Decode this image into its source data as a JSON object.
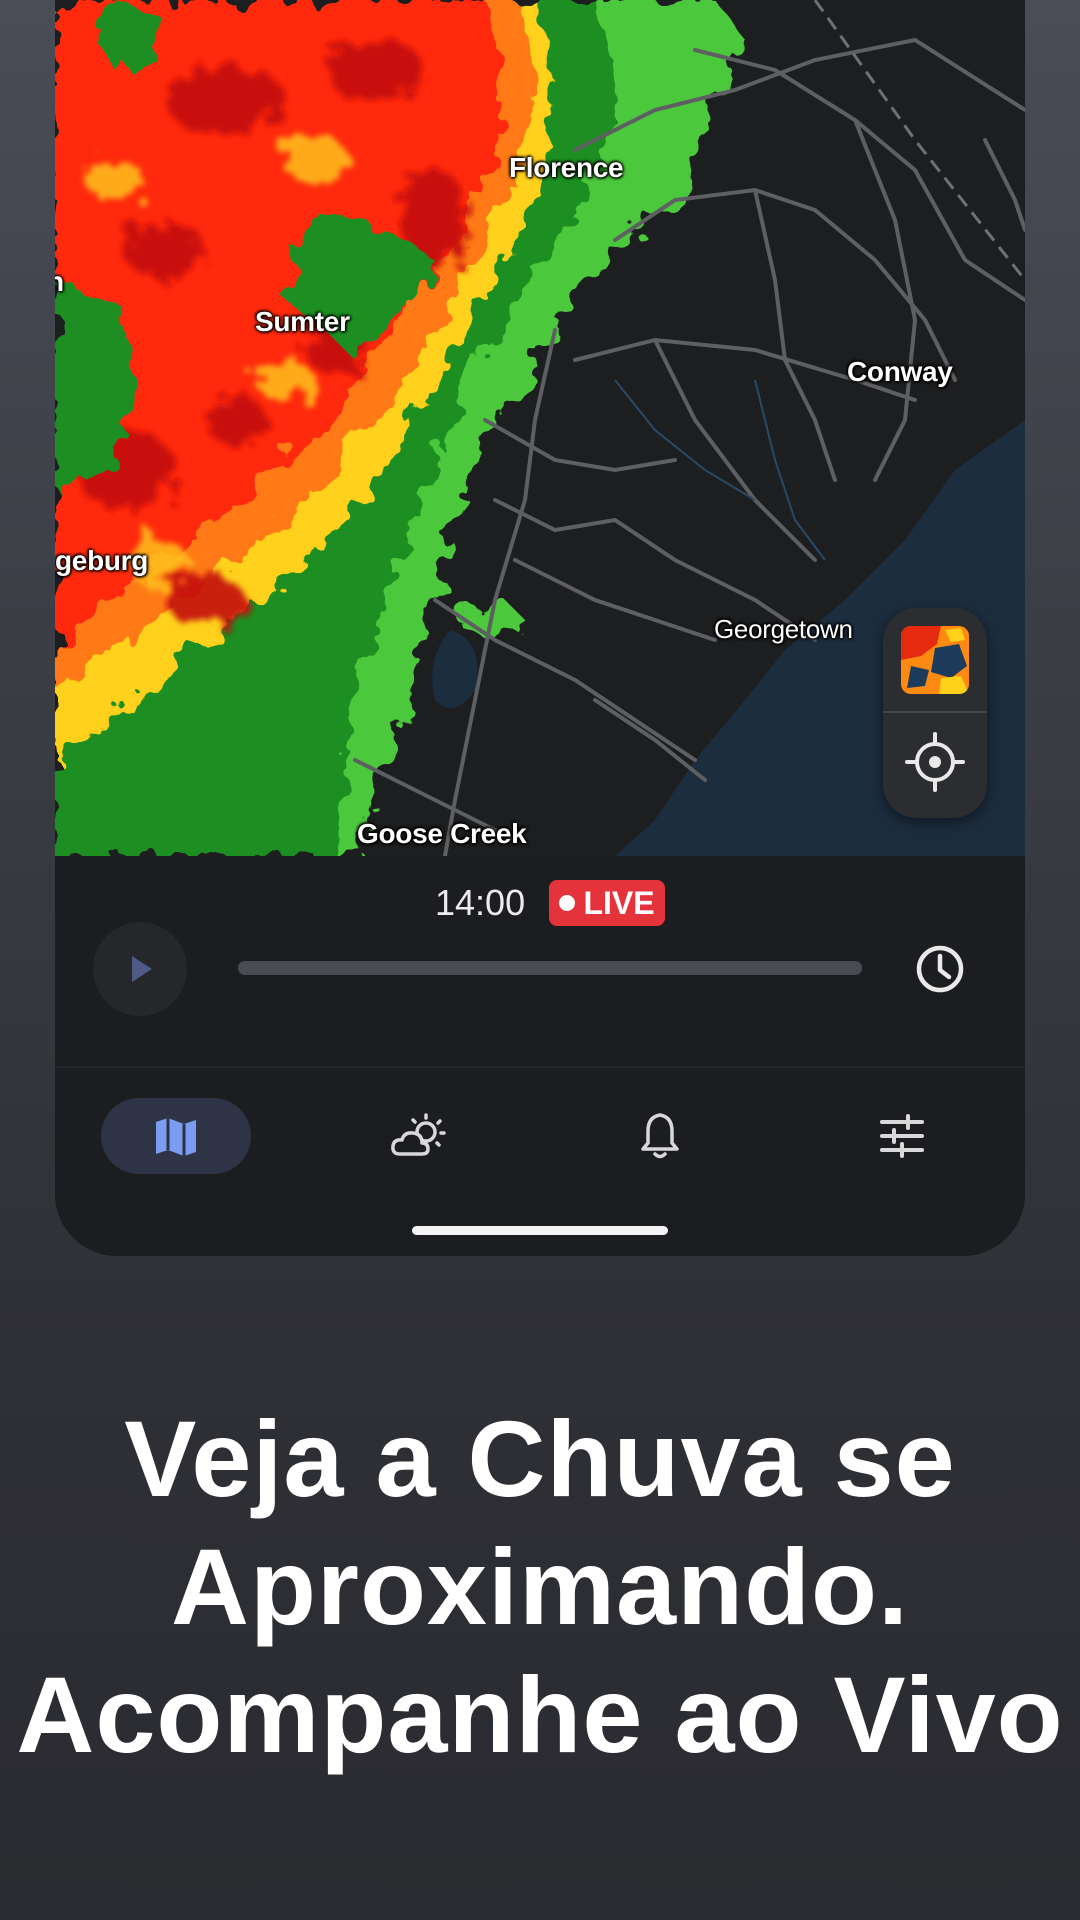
{
  "map": {
    "cities": {
      "florence": "Florence",
      "sumter": "Sumter",
      "conway": "Conway",
      "orangeburg": "geburg",
      "georgetown": "Georgetown",
      "goose_creek": "Goose Creek",
      "edge_letter": "n"
    },
    "colors": {
      "heavy": "#cc0a0a",
      "strong": "#ff4a12",
      "moderate": "#ffb800",
      "light": "#4cc83a",
      "very_light": "#1c7d1e",
      "water": "#1c2d3e",
      "roads": "#5e5f63"
    },
    "controls": {
      "layer_icon": "radar-thumbnail-icon",
      "locate_icon": "crosshair-icon"
    }
  },
  "timeline": {
    "time": "14:00",
    "live_label": "LIVE",
    "live_color": "#e5333c",
    "play_icon": "play-icon",
    "history_icon": "clock-icon",
    "progress": 1.0
  },
  "nav": {
    "items": [
      {
        "name": "map",
        "icon": "map-icon",
        "active": true
      },
      {
        "name": "forecast",
        "icon": "partly-cloudy-icon",
        "active": false
      },
      {
        "name": "alerts",
        "icon": "bell-icon",
        "active": false
      },
      {
        "name": "settings",
        "icon": "sliders-icon",
        "active": false
      }
    ],
    "accent": "#7b9cf0"
  },
  "headline": {
    "line1": "Veja a Chuva se",
    "line2": "Aproximando.",
    "line3": "Acompanhe ao Vivo"
  }
}
